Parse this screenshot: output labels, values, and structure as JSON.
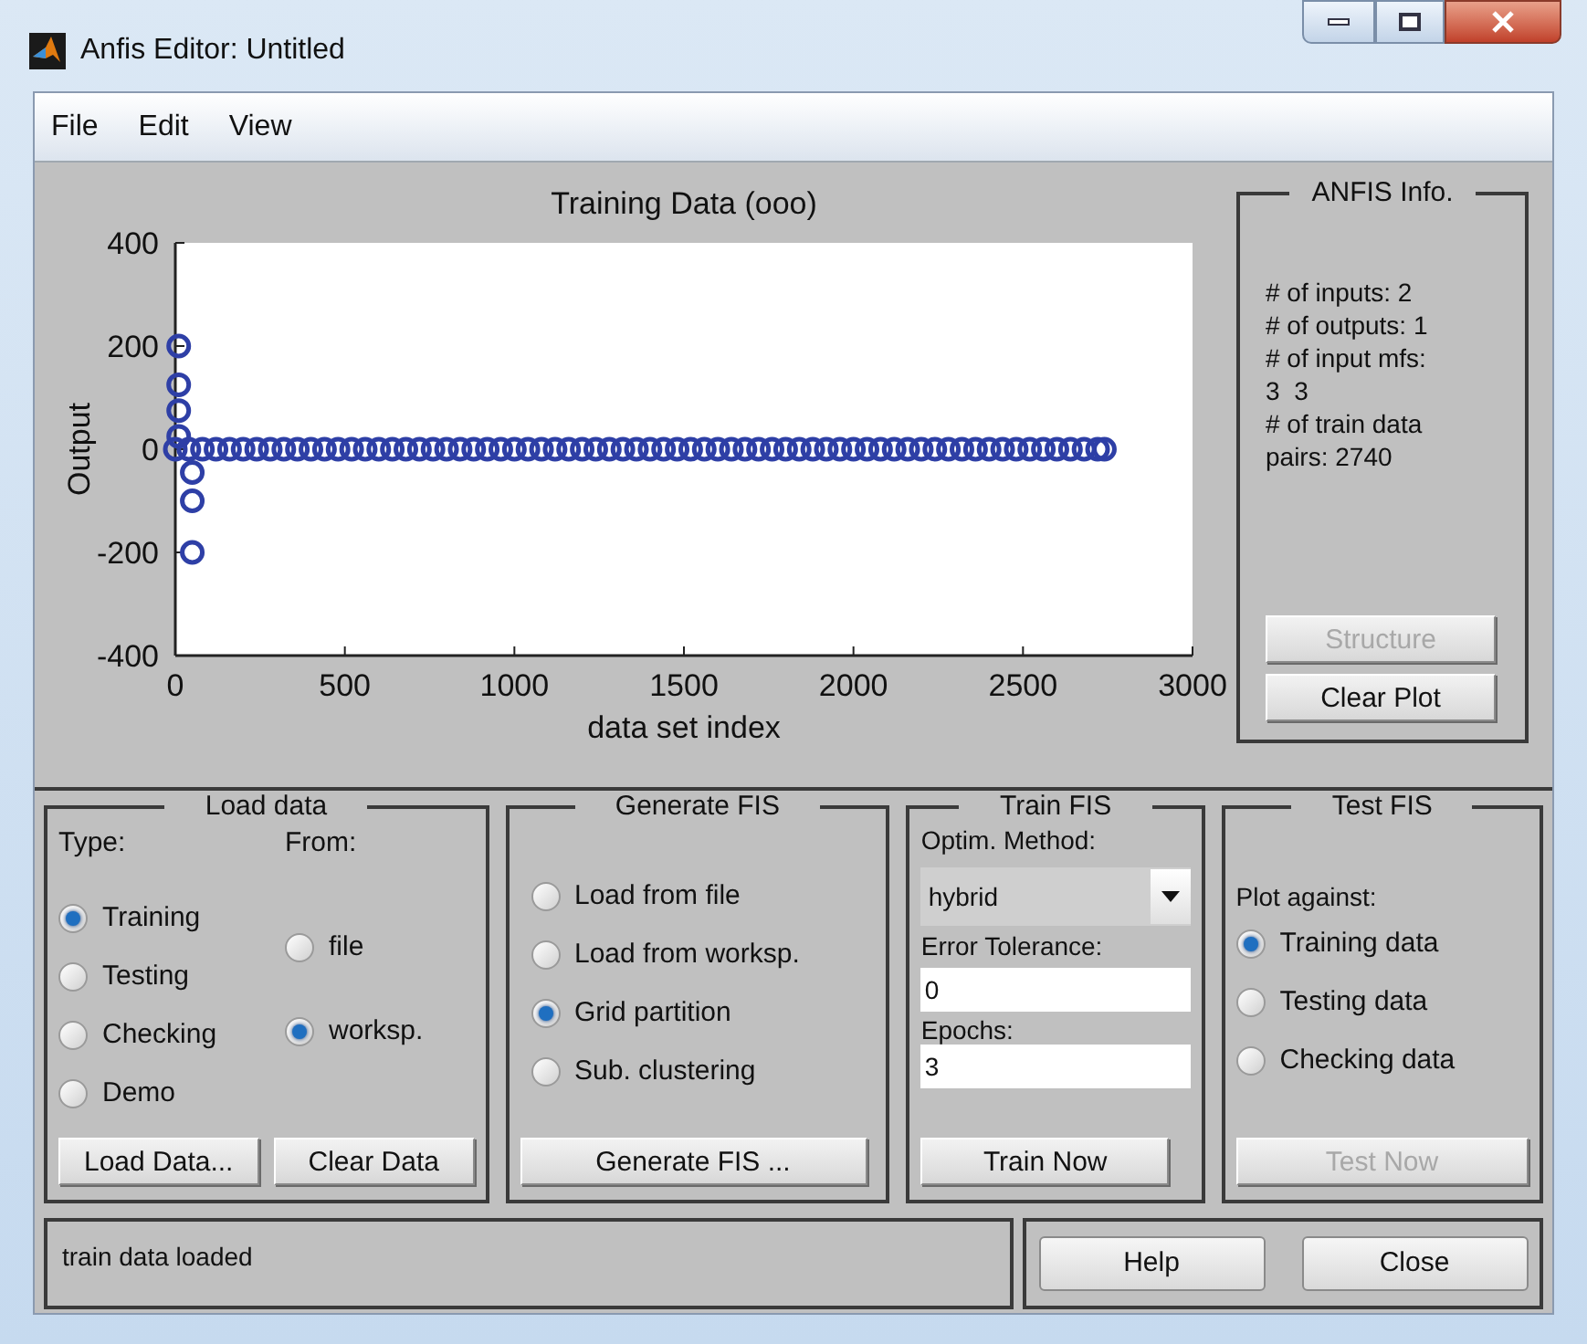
{
  "window": {
    "title": "Anfis Editor: Untitled"
  },
  "menu": [
    "File",
    "Edit",
    "View"
  ],
  "plot": {
    "chart_data": {
      "type": "scatter",
      "title": "Training Data (ooo)",
      "xlabel": "data set index",
      "ylabel": "Output",
      "xlim": [
        0,
        3000
      ],
      "ylim": [
        -400,
        400
      ],
      "xticks": [
        0,
        500,
        1000,
        1500,
        2000,
        2500,
        3000
      ],
      "yticks": [
        -400,
        -200,
        0,
        200,
        400
      ],
      "x": [
        10,
        10,
        10,
        10,
        50,
        50,
        50,
        0,
        40,
        80,
        120,
        160,
        200,
        240,
        280,
        320,
        360,
        400,
        440,
        480,
        520,
        560,
        600,
        640,
        680,
        720,
        760,
        800,
        840,
        880,
        920,
        960,
        1000,
        1040,
        1080,
        1120,
        1160,
        1200,
        1240,
        1280,
        1320,
        1360,
        1400,
        1440,
        1480,
        1520,
        1560,
        1600,
        1640,
        1680,
        1720,
        1760,
        1800,
        1840,
        1880,
        1920,
        1960,
        2000,
        2040,
        2080,
        2120,
        2160,
        2200,
        2240,
        2280,
        2320,
        2360,
        2400,
        2440,
        2480,
        2520,
        2560,
        2600,
        2640,
        2680,
        2720,
        2740
      ],
      "values": [
        200,
        125,
        75,
        25,
        -45,
        -100,
        -200,
        0,
        0,
        0,
        0,
        0,
        0,
        0,
        0,
        0,
        0,
        0,
        0,
        0,
        0,
        0,
        0,
        0,
        0,
        0,
        0,
        0,
        0,
        0,
        0,
        0,
        0,
        0,
        0,
        0,
        0,
        0,
        0,
        0,
        0,
        0,
        0,
        0,
        0,
        0,
        0,
        0,
        0,
        0,
        0,
        0,
        0,
        0,
        0,
        0,
        0,
        0,
        0,
        0,
        0,
        0,
        0,
        0,
        0,
        0,
        0,
        0,
        0,
        0,
        0,
        0,
        0,
        0,
        0,
        0,
        0
      ]
    }
  },
  "anfis_info": {
    "title": "ANFIS Info.",
    "lines": [
      "# of inputs: 2",
      "# of outputs: 1",
      "# of input mfs:",
      "3  3",
      "# of train data",
      "pairs: 2740"
    ],
    "buttons": [
      {
        "label": "Structure",
        "disabled": true
      },
      {
        "label": "Clear Plot",
        "disabled": false
      }
    ]
  },
  "load_data": {
    "title": "Load data",
    "type_label": "Type:",
    "from_label": "From:",
    "types": [
      {
        "label": "Training",
        "selected": true
      },
      {
        "label": "Testing",
        "selected": false
      },
      {
        "label": "Checking",
        "selected": false
      },
      {
        "label": "Demo",
        "selected": false
      }
    ],
    "sources": [
      {
        "label": "file",
        "selected": false
      },
      {
        "label": "worksp.",
        "selected": true
      }
    ],
    "buttons": [
      {
        "label": "Load Data...",
        "disabled": false
      },
      {
        "label": "Clear Data",
        "disabled": false
      }
    ]
  },
  "generate_fis": {
    "title": "Generate FIS",
    "options": [
      {
        "label": "Load from file",
        "selected": false
      },
      {
        "label": "Load from worksp.",
        "selected": false
      },
      {
        "label": "Grid partition",
        "selected": true
      },
      {
        "label": "Sub. clustering",
        "selected": false
      }
    ],
    "button": {
      "label": "Generate FIS ...",
      "disabled": false
    }
  },
  "train_fis": {
    "title": "Train FIS",
    "method_label": "Optim. Method:",
    "method": "hybrid",
    "tolerance_label": "Error Tolerance:",
    "tolerance": "0",
    "epochs_label": "Epochs:",
    "epochs": "3",
    "button": {
      "label": "Train Now",
      "disabled": false
    }
  },
  "test_fis": {
    "title": "Test FIS",
    "plot_label": "Plot against:",
    "options": [
      {
        "label": "Training data",
        "selected": true
      },
      {
        "label": "Testing data",
        "selected": false
      },
      {
        "label": "Checking data",
        "selected": false
      }
    ],
    "button": {
      "label": "Test Now",
      "disabled": true
    }
  },
  "status": "train data loaded",
  "buttons": [
    "Help",
    "Close"
  ]
}
